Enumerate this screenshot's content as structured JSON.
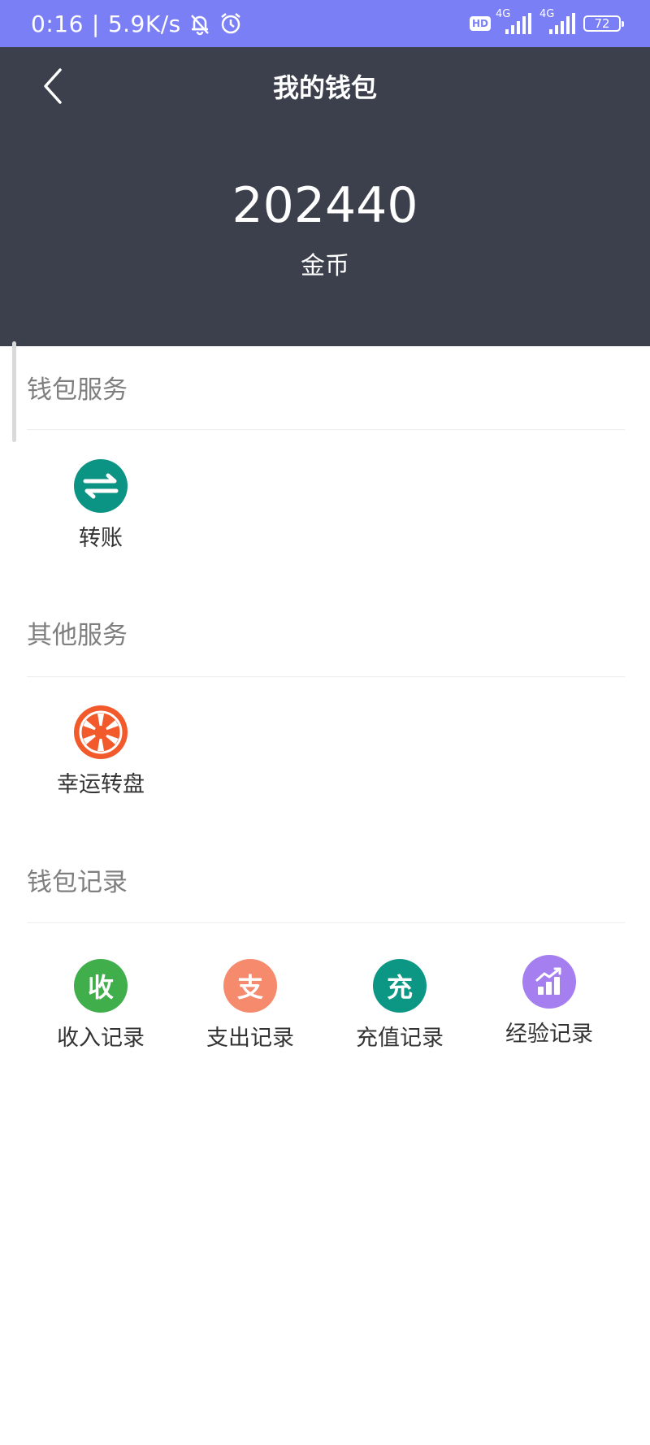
{
  "status_bar": {
    "time": "0:16",
    "speed": "5.9K/s",
    "hd": "HD",
    "network_1": "4G",
    "network_2": "4G",
    "battery": "72"
  },
  "header": {
    "title": "我的钱包",
    "balance": "202440",
    "unit": "金币",
    "back_icon": "chevron-left-icon"
  },
  "sections": [
    {
      "title": "钱包服务",
      "items": [
        {
          "label": "转账",
          "icon": "transfer-icon",
          "color": "#0b9383"
        }
      ]
    },
    {
      "title": "其他服务",
      "items": [
        {
          "label": "幸运转盘",
          "icon": "lucky-wheel-icon",
          "color": "#f25a2c"
        }
      ]
    },
    {
      "title": "钱包记录",
      "items": [
        {
          "label": "收入记录",
          "icon": "income-icon",
          "glyph": "收",
          "color": "#3fae4b"
        },
        {
          "label": "支出记录",
          "icon": "expense-icon",
          "glyph": "支",
          "color": "#f58a6c"
        },
        {
          "label": "充值记录",
          "icon": "recharge-icon",
          "glyph": "充",
          "color": "#0c9684"
        },
        {
          "label": "经验记录",
          "icon": "experience-chart-icon",
          "color": "#a57ff0"
        }
      ]
    }
  ]
}
